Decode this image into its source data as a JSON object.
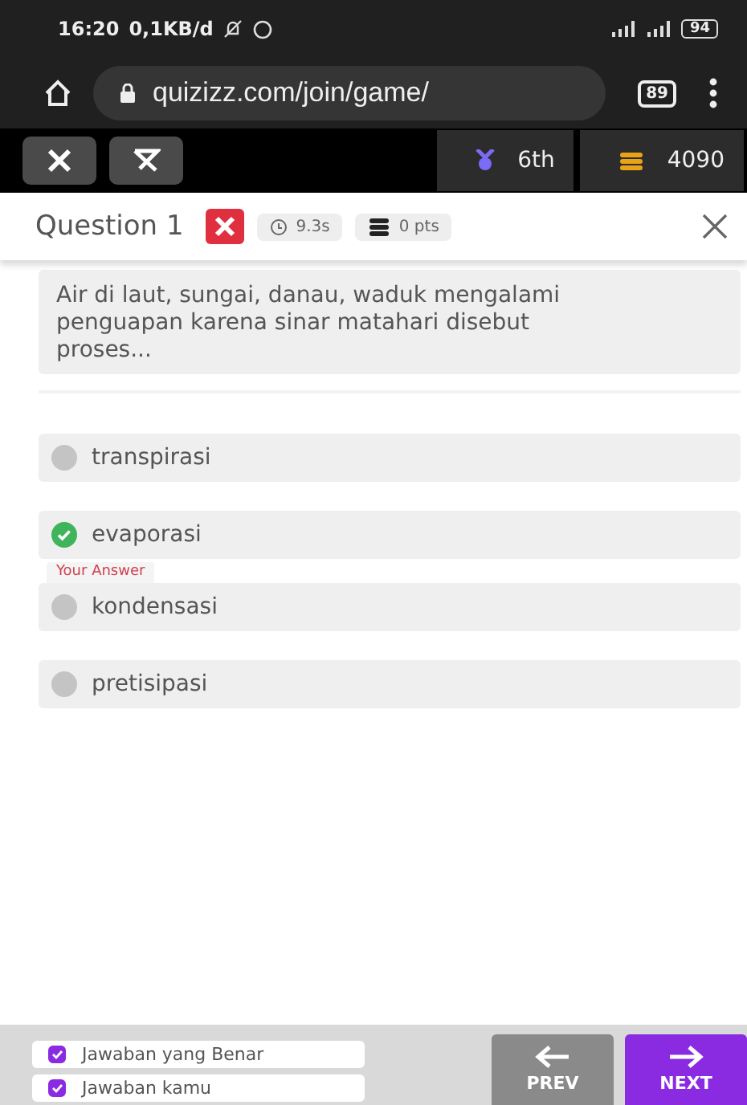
{
  "status_bar": {
    "time": "16:20",
    "data_rate": "0,1KB/d",
    "battery": "94"
  },
  "browser": {
    "url": "quizizz.com/join/game/",
    "tab_count": "89"
  },
  "game_bar": {
    "rank": "6th",
    "coins": "4090"
  },
  "question": {
    "title": "Question 1",
    "answered_correctly": false,
    "time": "9.3s",
    "points": "0 pts",
    "text": "Air di laut, sungai, danau, waduk mengalami penguapan karena sinar matahari disebut proses..."
  },
  "options": [
    {
      "text": "transpirasi",
      "correct": false
    },
    {
      "text": "evaporasi",
      "correct": true
    },
    {
      "text": "kondensasi",
      "correct": false,
      "tag": "Your Answer"
    },
    {
      "text": "pretisipasi",
      "correct": false
    }
  ],
  "legend": [
    {
      "label": "Jawaban yang Benar",
      "checked": true
    },
    {
      "label": "Jawaban kamu",
      "checked": true
    }
  ],
  "nav": {
    "prev": "PREV",
    "next": "NEXT"
  }
}
